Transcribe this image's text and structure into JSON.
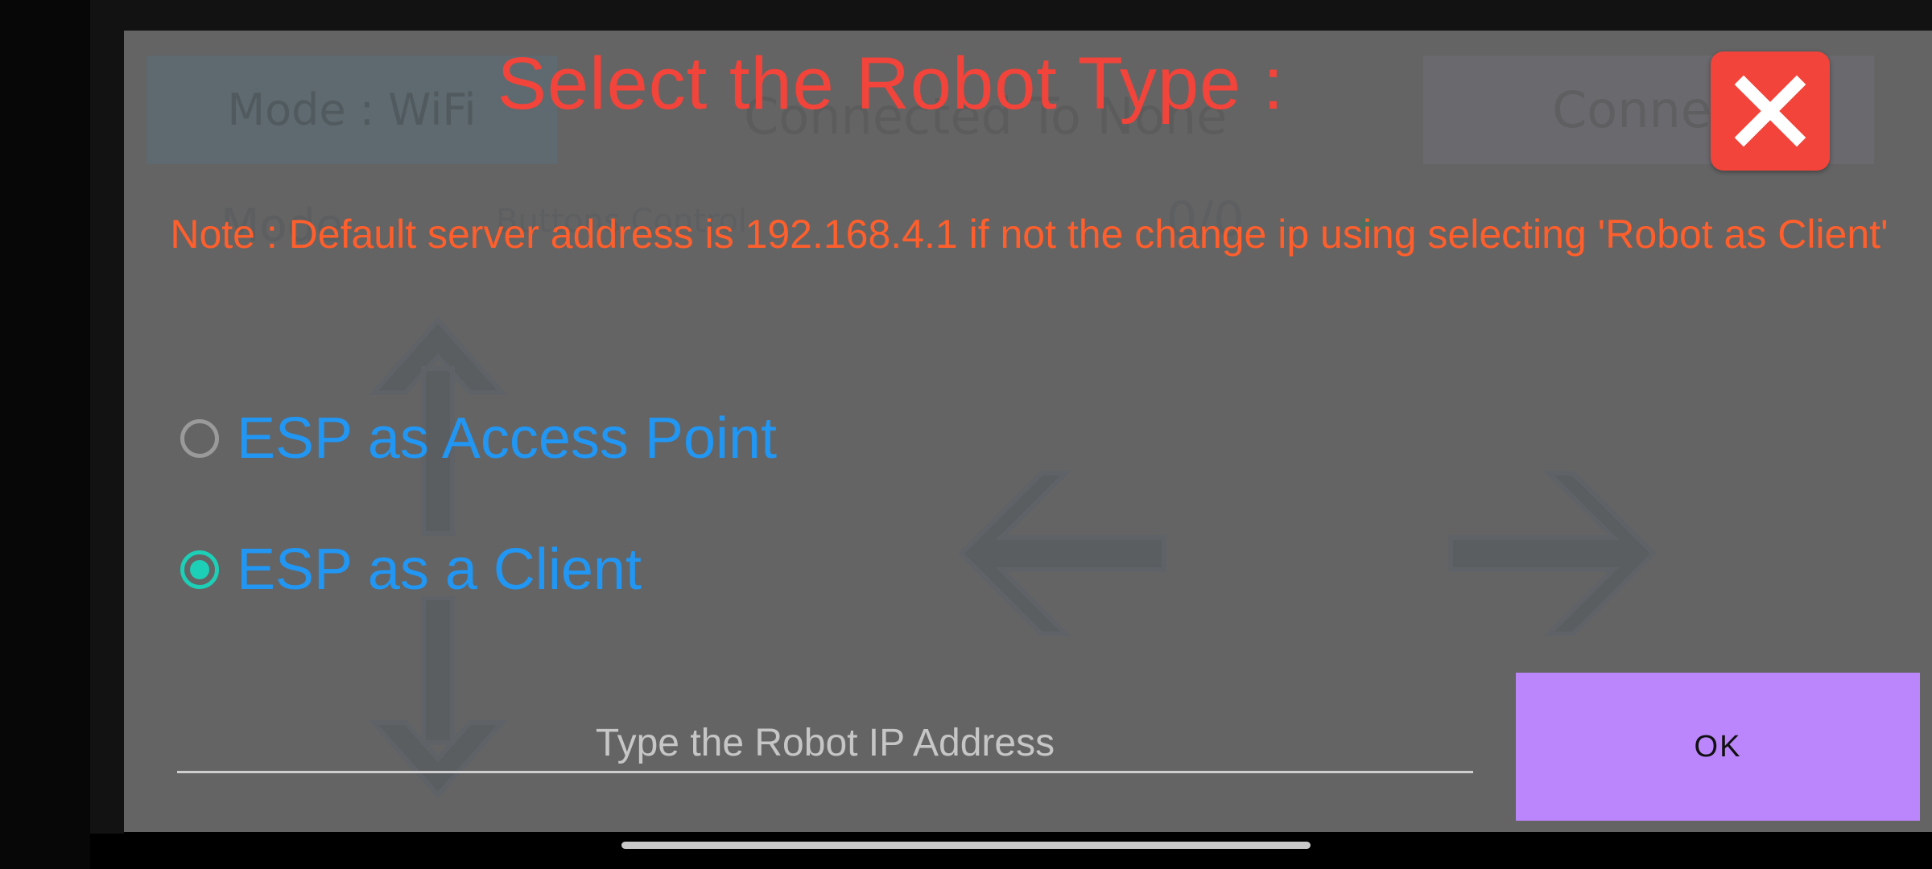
{
  "background_ui": {
    "mode_button_label": "Mode : WiFi",
    "connection_status": "Connected To None",
    "connect_button_label": "Connect",
    "mode_label": "Mode",
    "control_label": "Buttons Control",
    "counter": "0/0"
  },
  "dialog": {
    "title": "Select the Robot Type :",
    "note": "Note : Default server address is 192.168.4.1 if not the change ip using selecting 'Robot as Client'",
    "options": [
      {
        "label": "ESP as Access Point",
        "selected": false
      },
      {
        "label": "ESP as a Client",
        "selected": true
      }
    ],
    "ip_input": {
      "placeholder": "Type the Robot IP Address",
      "value": ""
    },
    "ok_label": "OK",
    "close_icon": "close-x-icon"
  },
  "colors": {
    "title": "#f2443a",
    "note": "#ff5f2c",
    "option_text": "#2196f3",
    "radio_selected": "#1ccfb6",
    "ok_button": "#bb86fc",
    "close_button": "#f2443a",
    "overlay": "#646464"
  }
}
